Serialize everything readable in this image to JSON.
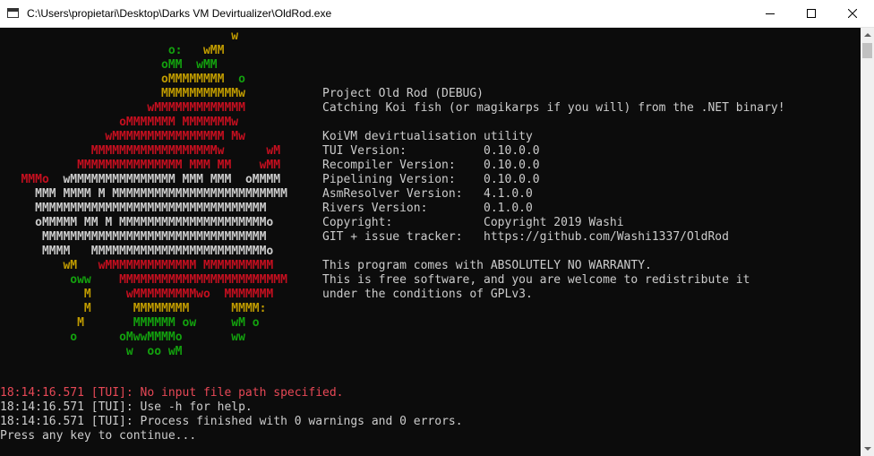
{
  "window": {
    "title": "C:\\Users\\propietari\\Desktop\\Darks VM Devirtualizer\\OldRod.exe"
  },
  "palette": {
    "green": "#13a10e",
    "olive": "#c19c00",
    "yellow": "#f9f1a5",
    "red": "#c50f1f",
    "white": "#cccccc",
    "bright_white": "#f2f2f2",
    "gray": "#767676"
  },
  "ascii_art": [
    [
      "                                 ",
      "y",
      "w"
    ],
    [
      "                        ",
      "g",
      "o:   ",
      "y",
      "wMM"
    ],
    [
      "                       ",
      "g",
      "oMM  ",
      "g",
      "wMM"
    ],
    [
      "                       ",
      "y",
      "oMMMMMMMM  ",
      "g",
      "o"
    ],
    [
      "                       ",
      "y",
      "MMMMMMMMMMMw"
    ],
    [
      "                     ",
      "r",
      "wMMMMMMMMMMMMM"
    ],
    [
      "                 ",
      "r",
      "oMMMMMMM MMMMMMMw"
    ],
    [
      "               ",
      "r",
      "wMMMMMMMMMMMMMMMM Mw"
    ],
    [
      "             ",
      "r",
      "MMMMMMMMMMMMMMMMMMw      wM"
    ],
    [
      "           ",
      "r",
      "MMMMMMMMMMMMMMM MMM MM    wMM"
    ],
    [
      "   ",
      "r",
      "MMMo  ",
      "w",
      "wMMMMMMMMMMMMMMM MMM MMM  oMMMM"
    ],
    [
      "     ",
      "w",
      "MMM MMMM M MMMMMMMMMMMMMMMMMMMMMMMMM"
    ],
    [
      "     ",
      "w",
      "MMMMMMMMMMMMMMMMMMMMMMMMMMMMMMMMM"
    ],
    [
      "     ",
      "w",
      "oMMMMM MM M MMMMMMMMMMMMMMMMMMMMMo"
    ],
    [
      "      ",
      "w",
      "MMMMMMMMMMMMMMMMMMMMMMMMMMMMMMMM"
    ],
    [
      "      ",
      "w",
      "MMMM   MMMMMMMMMMMMMMMMMMMMMMMMMo"
    ],
    [
      "         ",
      "y",
      "wM   ",
      "r",
      "wMMMMMMMMMMMMM MMMMMMMMMM"
    ],
    [
      "          ",
      "g",
      "oww    ",
      "r",
      "MMMMMMMMMMMMMMMMMMMMMMMM"
    ],
    [
      "            ",
      "y",
      "M     ",
      "r",
      "wMMMMMMMMMwo  MMMMMMM"
    ],
    [
      "            ",
      "y",
      "M      ",
      "y",
      "MMMMMMMM      MMMM:"
    ],
    [
      "           ",
      "y",
      "M       ",
      "g",
      "MMMMMM ow     wM o"
    ],
    [
      "          ",
      "g",
      "o      ",
      "g",
      "oMwwMMMMo       ww"
    ],
    [
      "                  ",
      "g",
      "w  oo wM"
    ]
  ],
  "info_lines": [
    "Project Old Rod (DEBUG)",
    "Catching Koi fish (or magikarps if you will) from the .NET binary!",
    "",
    "KoiVM devirtualisation utility",
    "TUI Version:           0.10.0.0",
    "Recompiler Version:    0.10.0.0",
    "Pipelining Version:    0.10.0.0",
    "AsmResolver Version:   4.1.0.0",
    "Rivers Version:        0.1.0.0",
    "Copyright:             Copyright 2019 Washi",
    "GIT + issue tracker:   https://github.com/Washi1337/OldRod",
    "",
    "This program comes with ABSOLUTELY NO WARRANTY.",
    "This is free software, and you are welcome to redistribute it",
    "under the conditions of GPLv3."
  ],
  "log": [
    {
      "text": "18:14:16.571 [TUI]: No input file path specified.",
      "level": "error"
    },
    {
      "text": "18:14:16.571 [TUI]: Use -h for help.",
      "level": "info"
    },
    {
      "text": "18:14:16.571 [TUI]: Process finished with 0 warnings and 0 errors.",
      "level": "info"
    },
    {
      "text": "Press any key to continue...",
      "level": "info"
    }
  ]
}
